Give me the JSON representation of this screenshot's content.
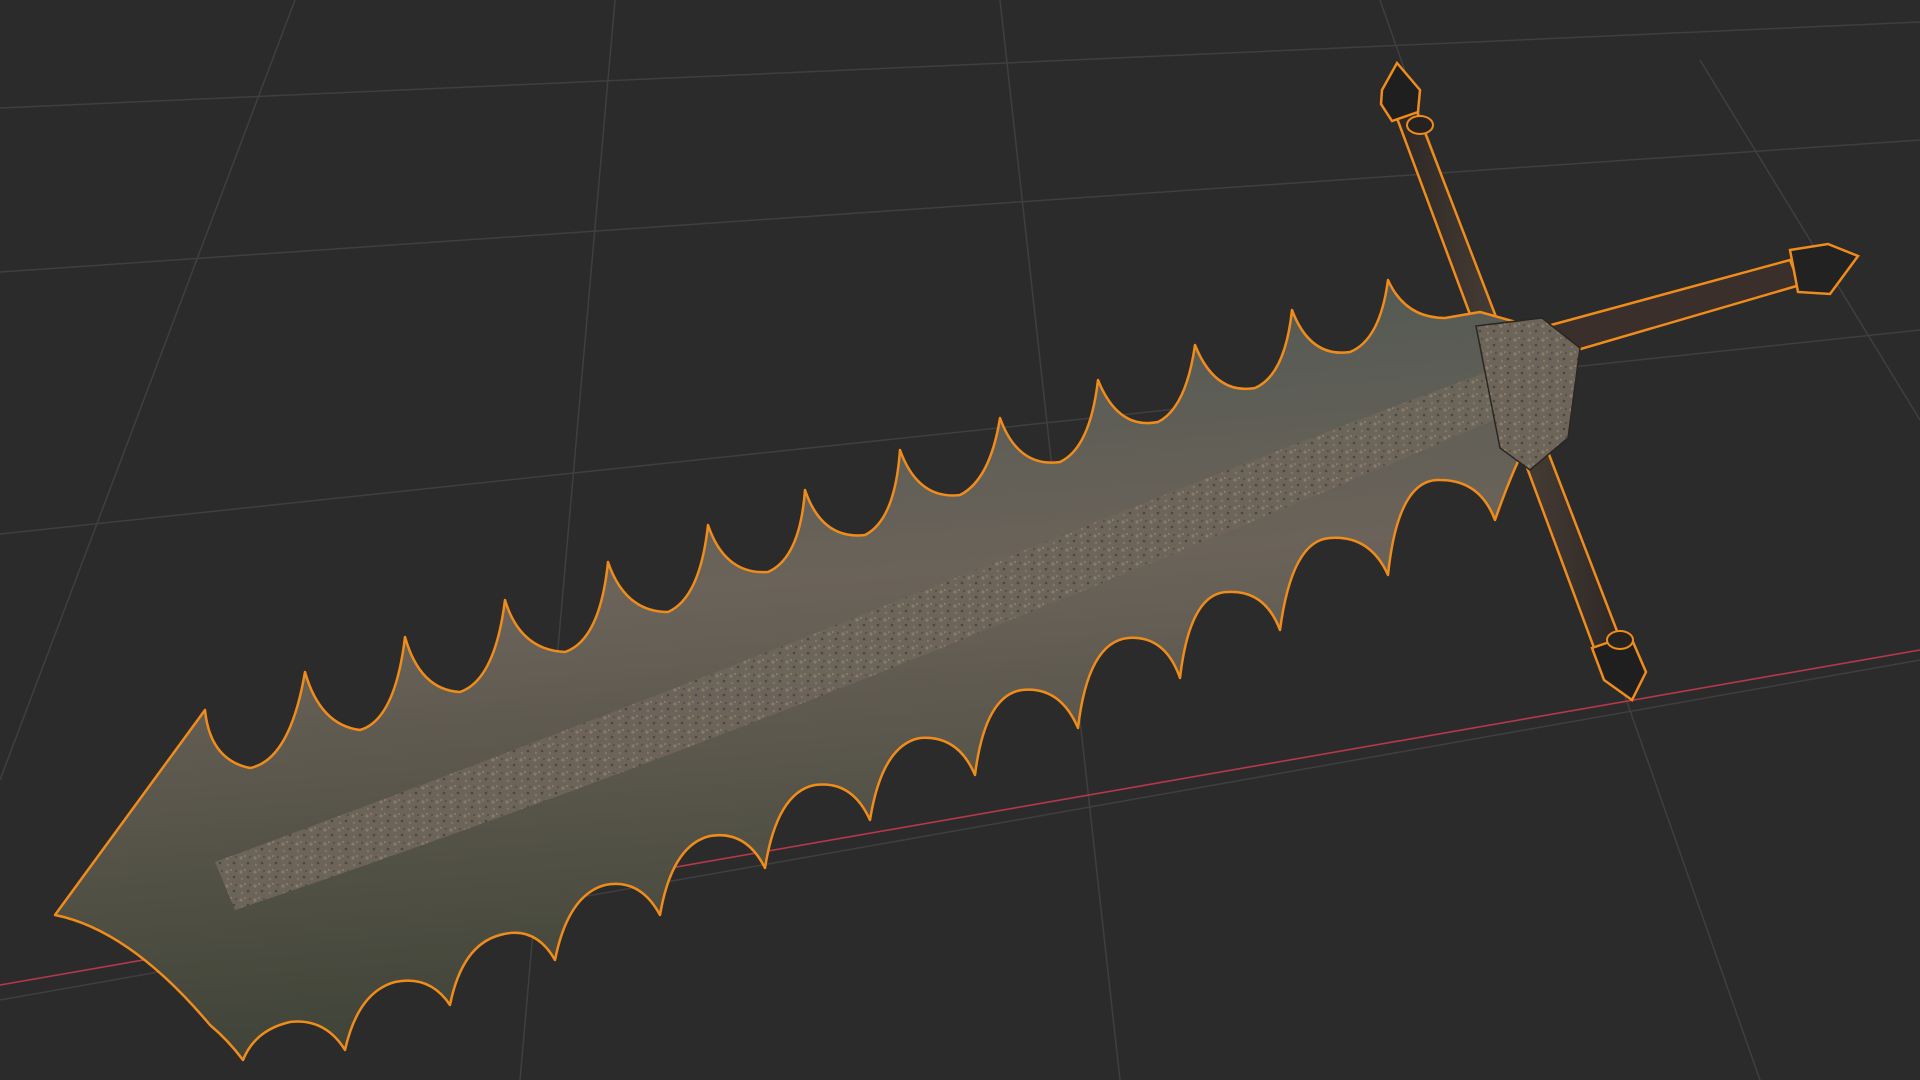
{
  "viewport": {
    "background_color": "#2b2b2b",
    "grid_line_color": "#3d3d3d",
    "x_axis_color": "#c23a4a",
    "selection_outline_color": "#f08c1c"
  },
  "object": {
    "kind": "sword",
    "selected": true,
    "blade_color": "#5b5a55",
    "blade_shadow_color": "#3a3d36",
    "handle_color": "#2f2a26",
    "tip_color": "#1e1e1e"
  }
}
